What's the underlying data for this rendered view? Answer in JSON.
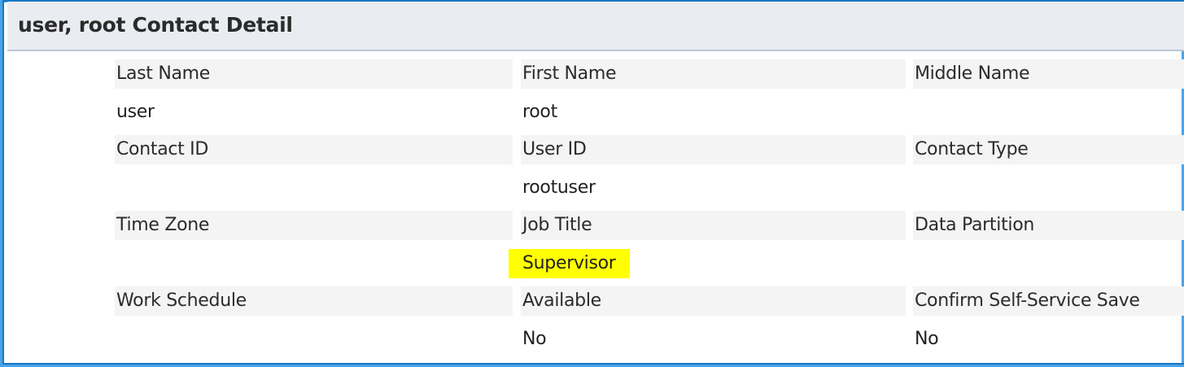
{
  "header": {
    "title": "user, root Contact Detail"
  },
  "rows": [
    {
      "labels": [
        "Last Name",
        "First Name",
        "Middle Name"
      ],
      "values": [
        "user",
        "root",
        ""
      ]
    },
    {
      "labels": [
        "Contact ID",
        "User ID",
        "Contact Type"
      ],
      "values": [
        "",
        "rootuser",
        ""
      ]
    },
    {
      "labels": [
        "Time Zone",
        "Job Title",
        "Data Partition"
      ],
      "values": [
        "",
        "Supervisor",
        ""
      ]
    },
    {
      "labels": [
        "Work Schedule",
        "Available",
        "Confirm Self-Service Save"
      ],
      "values": [
        "",
        "No",
        "No"
      ]
    }
  ],
  "colors": {
    "highlight": "#ffff00",
    "border": "#4aa3ea"
  }
}
